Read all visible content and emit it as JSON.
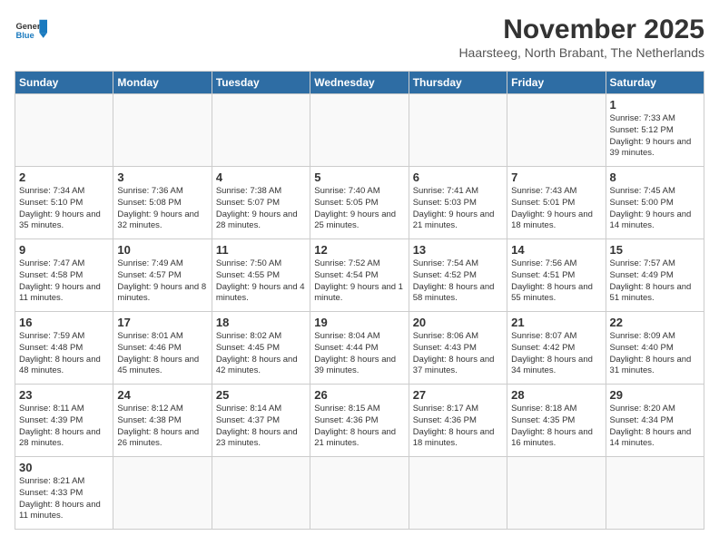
{
  "header": {
    "logo_general": "General",
    "logo_blue": "Blue",
    "month_title": "November 2025",
    "subtitle": "Haarsteeg, North Brabant, The Netherlands"
  },
  "weekdays": [
    "Sunday",
    "Monday",
    "Tuesday",
    "Wednesday",
    "Thursday",
    "Friday",
    "Saturday"
  ],
  "weeks": [
    [
      {
        "day": "",
        "info": ""
      },
      {
        "day": "",
        "info": ""
      },
      {
        "day": "",
        "info": ""
      },
      {
        "day": "",
        "info": ""
      },
      {
        "day": "",
        "info": ""
      },
      {
        "day": "",
        "info": ""
      },
      {
        "day": "1",
        "info": "Sunrise: 7:33 AM\nSunset: 5:12 PM\nDaylight: 9 hours\nand 39 minutes."
      }
    ],
    [
      {
        "day": "2",
        "info": "Sunrise: 7:34 AM\nSunset: 5:10 PM\nDaylight: 9 hours\nand 35 minutes."
      },
      {
        "day": "3",
        "info": "Sunrise: 7:36 AM\nSunset: 5:08 PM\nDaylight: 9 hours\nand 32 minutes."
      },
      {
        "day": "4",
        "info": "Sunrise: 7:38 AM\nSunset: 5:07 PM\nDaylight: 9 hours\nand 28 minutes."
      },
      {
        "day": "5",
        "info": "Sunrise: 7:40 AM\nSunset: 5:05 PM\nDaylight: 9 hours\nand 25 minutes."
      },
      {
        "day": "6",
        "info": "Sunrise: 7:41 AM\nSunset: 5:03 PM\nDaylight: 9 hours\nand 21 minutes."
      },
      {
        "day": "7",
        "info": "Sunrise: 7:43 AM\nSunset: 5:01 PM\nDaylight: 9 hours\nand 18 minutes."
      },
      {
        "day": "8",
        "info": "Sunrise: 7:45 AM\nSunset: 5:00 PM\nDaylight: 9 hours\nand 14 minutes."
      }
    ],
    [
      {
        "day": "9",
        "info": "Sunrise: 7:47 AM\nSunset: 4:58 PM\nDaylight: 9 hours\nand 11 minutes."
      },
      {
        "day": "10",
        "info": "Sunrise: 7:49 AM\nSunset: 4:57 PM\nDaylight: 9 hours\nand 8 minutes."
      },
      {
        "day": "11",
        "info": "Sunrise: 7:50 AM\nSunset: 4:55 PM\nDaylight: 9 hours\nand 4 minutes."
      },
      {
        "day": "12",
        "info": "Sunrise: 7:52 AM\nSunset: 4:54 PM\nDaylight: 9 hours\nand 1 minute."
      },
      {
        "day": "13",
        "info": "Sunrise: 7:54 AM\nSunset: 4:52 PM\nDaylight: 8 hours\nand 58 minutes."
      },
      {
        "day": "14",
        "info": "Sunrise: 7:56 AM\nSunset: 4:51 PM\nDaylight: 8 hours\nand 55 minutes."
      },
      {
        "day": "15",
        "info": "Sunrise: 7:57 AM\nSunset: 4:49 PM\nDaylight: 8 hours\nand 51 minutes."
      }
    ],
    [
      {
        "day": "16",
        "info": "Sunrise: 7:59 AM\nSunset: 4:48 PM\nDaylight: 8 hours\nand 48 minutes."
      },
      {
        "day": "17",
        "info": "Sunrise: 8:01 AM\nSunset: 4:46 PM\nDaylight: 8 hours\nand 45 minutes."
      },
      {
        "day": "18",
        "info": "Sunrise: 8:02 AM\nSunset: 4:45 PM\nDaylight: 8 hours\nand 42 minutes."
      },
      {
        "day": "19",
        "info": "Sunrise: 8:04 AM\nSunset: 4:44 PM\nDaylight: 8 hours\nand 39 minutes."
      },
      {
        "day": "20",
        "info": "Sunrise: 8:06 AM\nSunset: 4:43 PM\nDaylight: 8 hours\nand 37 minutes."
      },
      {
        "day": "21",
        "info": "Sunrise: 8:07 AM\nSunset: 4:42 PM\nDaylight: 8 hours\nand 34 minutes."
      },
      {
        "day": "22",
        "info": "Sunrise: 8:09 AM\nSunset: 4:40 PM\nDaylight: 8 hours\nand 31 minutes."
      }
    ],
    [
      {
        "day": "23",
        "info": "Sunrise: 8:11 AM\nSunset: 4:39 PM\nDaylight: 8 hours\nand 28 minutes."
      },
      {
        "day": "24",
        "info": "Sunrise: 8:12 AM\nSunset: 4:38 PM\nDaylight: 8 hours\nand 26 minutes."
      },
      {
        "day": "25",
        "info": "Sunrise: 8:14 AM\nSunset: 4:37 PM\nDaylight: 8 hours\nand 23 minutes."
      },
      {
        "day": "26",
        "info": "Sunrise: 8:15 AM\nSunset: 4:36 PM\nDaylight: 8 hours\nand 21 minutes."
      },
      {
        "day": "27",
        "info": "Sunrise: 8:17 AM\nSunset: 4:36 PM\nDaylight: 8 hours\nand 18 minutes."
      },
      {
        "day": "28",
        "info": "Sunrise: 8:18 AM\nSunset: 4:35 PM\nDaylight: 8 hours\nand 16 minutes."
      },
      {
        "day": "29",
        "info": "Sunrise: 8:20 AM\nSunset: 4:34 PM\nDaylight: 8 hours\nand 14 minutes."
      }
    ],
    [
      {
        "day": "30",
        "info": "Sunrise: 8:21 AM\nSunset: 4:33 PM\nDaylight: 8 hours\nand 11 minutes."
      },
      {
        "day": "",
        "info": ""
      },
      {
        "day": "",
        "info": ""
      },
      {
        "day": "",
        "info": ""
      },
      {
        "day": "",
        "info": ""
      },
      {
        "day": "",
        "info": ""
      },
      {
        "day": "",
        "info": ""
      }
    ]
  ]
}
